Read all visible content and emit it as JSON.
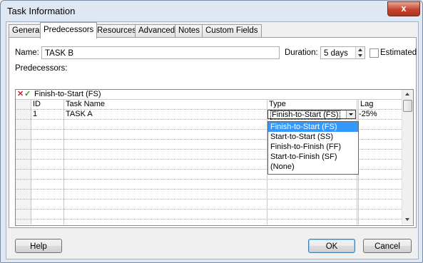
{
  "window": {
    "title": "Task Information",
    "close_glyph": "x"
  },
  "tabs": [
    {
      "label": "General"
    },
    {
      "label": "Predecessors"
    },
    {
      "label": "Resources"
    },
    {
      "label": "Advanced"
    },
    {
      "label": "Notes"
    },
    {
      "label": "Custom Fields"
    }
  ],
  "form": {
    "name_label": "Name:",
    "name_value": "TASK B",
    "duration_label": "Duration:",
    "duration_value": "5 days",
    "estimated_label": "Estimated",
    "predecessors_label": "Predecessors:"
  },
  "grid": {
    "edit_value": "Finish-to-Start (FS)",
    "columns": {
      "id": "ID",
      "task_name": "Task Name",
      "type": "Type",
      "lag": "Lag"
    },
    "rows": [
      {
        "id": "1",
        "task_name": "TASK A",
        "type": "Finish-to-Start (FS)",
        "lag": "-25%"
      }
    ],
    "type_options": [
      "Finish-to-Start (FS)",
      "Start-to-Start (SS)",
      "Finish-to-Finish (FF)",
      "Start-to-Finish (SF)",
      "(None)"
    ],
    "selected_option_index": 0
  },
  "buttons": {
    "help": "Help",
    "ok": "OK",
    "cancel": "Cancel"
  }
}
